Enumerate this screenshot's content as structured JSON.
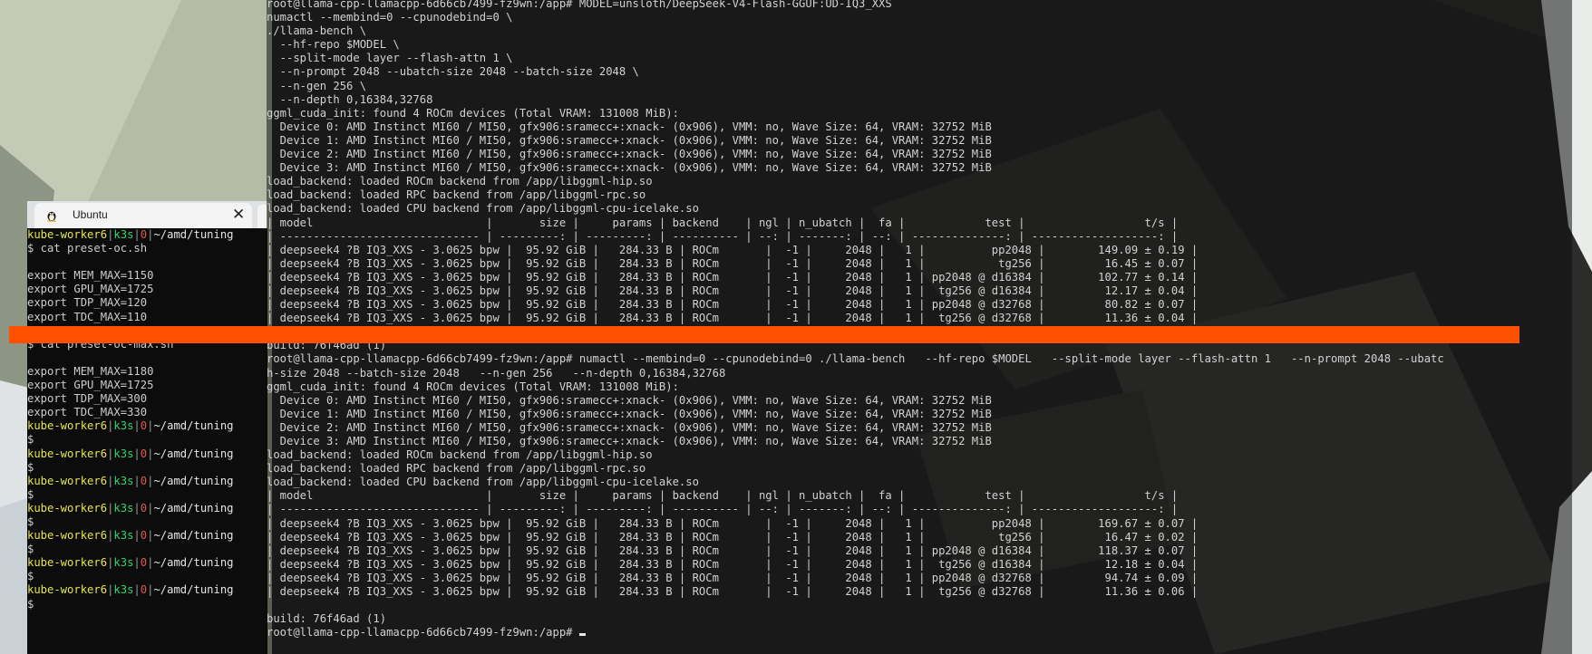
{
  "colors": {
    "terminal_bg": "#0c0c0c",
    "terminal_text": "#cccccc",
    "prompt_host": "#e5e54d",
    "prompt_k3s": "#2fd66a",
    "prompt_ctx": "#e25555",
    "redaction_bar": "#ff5000",
    "tab_bg": "#f4f4f4"
  },
  "left_terminal": {
    "tab": {
      "title": "Ubuntu",
      "icon": "linux-tux-icon",
      "close_glyph": "✕"
    },
    "prompt": {
      "host": "kube-worker6",
      "sep": "|",
      "k3s": "k3s",
      "ctx": "0",
      "path": "~/amd/tuning"
    },
    "lines": [
      {
        "type": "prompt"
      },
      {
        "type": "text",
        "text": "$ cat preset-oc.sh"
      },
      {
        "type": "text",
        "text": ""
      },
      {
        "type": "text",
        "text": "export MEM_MAX=1150"
      },
      {
        "type": "text",
        "text": "export GPU_MAX=1725"
      },
      {
        "type": "text",
        "text": "export TDP_MAX=120"
      },
      {
        "type": "text",
        "text": "export TDC_MAX=110"
      },
      {
        "type": "text",
        "text": ""
      },
      {
        "type": "text",
        "text": "$ cat preset-oc-max.sh"
      },
      {
        "type": "text",
        "text": ""
      },
      {
        "type": "text",
        "text": "export MEM_MAX=1180"
      },
      {
        "type": "text",
        "text": "export GPU_MAX=1725"
      },
      {
        "type": "text",
        "text": "export TDP_MAX=300"
      },
      {
        "type": "text",
        "text": "export TDC_MAX=330"
      },
      {
        "type": "prompt"
      },
      {
        "type": "text",
        "text": "$"
      },
      {
        "type": "prompt"
      },
      {
        "type": "text",
        "text": "$"
      },
      {
        "type": "prompt"
      },
      {
        "type": "text",
        "text": "$"
      },
      {
        "type": "prompt"
      },
      {
        "type": "text",
        "text": "$"
      },
      {
        "type": "prompt"
      },
      {
        "type": "text",
        "text": "$"
      },
      {
        "type": "prompt"
      },
      {
        "type": "text",
        "text": "$"
      },
      {
        "type": "prompt"
      },
      {
        "type": "text",
        "text": "$"
      }
    ]
  },
  "main_terminal": {
    "lines": [
      "root@llama-cpp-llamacpp-6d66cb7499-fz9wn:/app# MODEL=unsloth/DeepSeek-V4-Flash-GGUF:UD-IQ3_XXS",
      "numactl --membind=0 --cpunodebind=0 \\",
      "./llama-bench \\",
      "  --hf-repo $MODEL \\",
      "  --split-mode layer --flash-attn 1 \\",
      "  --n-prompt 2048 --ubatch-size 2048 --batch-size 2048 \\",
      "  --n-gen 256 \\",
      "  --n-depth 0,16384,32768",
      "ggml_cuda_init: found 4 ROCm devices (Total VRAM: 131008 MiB):",
      "  Device 0: AMD Instinct MI60 / MI50, gfx906:sramecc+:xnack- (0x906), VMM: no, Wave Size: 64, VRAM: 32752 MiB",
      "  Device 1: AMD Instinct MI60 / MI50, gfx906:sramecc+:xnack- (0x906), VMM: no, Wave Size: 64, VRAM: 32752 MiB",
      "  Device 2: AMD Instinct MI60 / MI50, gfx906:sramecc+:xnack- (0x906), VMM: no, Wave Size: 64, VRAM: 32752 MiB",
      "  Device 3: AMD Instinct MI60 / MI50, gfx906:sramecc+:xnack- (0x906), VMM: no, Wave Size: 64, VRAM: 32752 MiB",
      "load_backend: loaded ROCm backend from /app/libggml-hip.so",
      "load_backend: loaded RPC backend from /app/libggml-rpc.so",
      "load_backend: loaded CPU backend from /app/libggml-cpu-icelake.so",
      "| model                          |       size |     params | backend    | ngl | n_ubatch |  fa |            test |                  t/s |",
      "| ------------------------------ | ---------: | ---------: | ---------- | --: | -------: | --: | --------------: | -------------------: |",
      "| deepseek4 ?B IQ3_XXS - 3.0625 bpw |  95.92 GiB |   284.33 B | ROCm       |  -1 |     2048 |   1 |          pp2048 |        149.09 ± 0.19 |",
      "| deepseek4 ?B IQ3_XXS - 3.0625 bpw |  95.92 GiB |   284.33 B | ROCm       |  -1 |     2048 |   1 |           tg256 |         16.45 ± 0.07 |",
      "| deepseek4 ?B IQ3_XXS - 3.0625 bpw |  95.92 GiB |   284.33 B | ROCm       |  -1 |     2048 |   1 | pp2048 @ d16384 |        102.77 ± 0.14 |",
      "| deepseek4 ?B IQ3_XXS - 3.0625 bpw |  95.92 GiB |   284.33 B | ROCm       |  -1 |     2048 |   1 |  tg256 @ d16384 |         12.17 ± 0.04 |",
      "| deepseek4 ?B IQ3_XXS - 3.0625 bpw |  95.92 GiB |   284.33 B | ROCm       |  -1 |     2048 |   1 | pp2048 @ d32768 |         80.82 ± 0.07 |",
      "| deepseek4 ?B IQ3_XXS - 3.0625 bpw |  95.92 GiB |   284.33 B | ROCm       |  -1 |     2048 |   1 |  tg256 @ d32768 |         11.36 ± 0.04 |",
      "",
      "build: 76f46ad (1)",
      "root@llama-cpp-llamacpp-6d66cb7499-fz9wn:/app# numactl --membind=0 --cpunodebind=0 ./llama-bench   --hf-repo $MODEL   --split-mode layer --flash-attn 1   --n-prompt 2048 --ubatc",
      "h-size 2048 --batch-size 2048   --n-gen 256   --n-depth 0,16384,32768",
      "ggml_cuda_init: found 4 ROCm devices (Total VRAM: 131008 MiB):",
      "  Device 0: AMD Instinct MI60 / MI50, gfx906:sramecc+:xnack- (0x906), VMM: no, Wave Size: 64, VRAM: 32752 MiB",
      "  Device 1: AMD Instinct MI60 / MI50, gfx906:sramecc+:xnack- (0x906), VMM: no, Wave Size: 64, VRAM: 32752 MiB",
      "  Device 2: AMD Instinct MI60 / MI50, gfx906:sramecc+:xnack- (0x906), VMM: no, Wave Size: 64, VRAM: 32752 MiB",
      "  Device 3: AMD Instinct MI60 / MI50, gfx906:sramecc+:xnack- (0x906), VMM: no, Wave Size: 64, VRAM: 32752 MiB",
      "load_backend: loaded ROCm backend from /app/libggml-hip.so",
      "load_backend: loaded RPC backend from /app/libggml-rpc.so",
      "load_backend: loaded CPU backend from /app/libggml-cpu-icelake.so",
      "| model                          |       size |     params | backend    | ngl | n_ubatch |  fa |            test |                  t/s |",
      "| ------------------------------ | ---------: | ---------: | ---------- | --: | -------: | --: | --------------: | -------------------: |",
      "| deepseek4 ?B IQ3_XXS - 3.0625 bpw |  95.92 GiB |   284.33 B | ROCm       |  -1 |     2048 |   1 |          pp2048 |        169.67 ± 0.07 |",
      "| deepseek4 ?B IQ3_XXS - 3.0625 bpw |  95.92 GiB |   284.33 B | ROCm       |  -1 |     2048 |   1 |           tg256 |         16.47 ± 0.02 |",
      "| deepseek4 ?B IQ3_XXS - 3.0625 bpw |  95.92 GiB |   284.33 B | ROCm       |  -1 |     2048 |   1 | pp2048 @ d16384 |        118.37 ± 0.07 |",
      "| deepseek4 ?B IQ3_XXS - 3.0625 bpw |  95.92 GiB |   284.33 B | ROCm       |  -1 |     2048 |   1 |  tg256 @ d16384 |         12.18 ± 0.04 |",
      "| deepseek4 ?B IQ3_XXS - 3.0625 bpw |  95.92 GiB |   284.33 B | ROCm       |  -1 |     2048 |   1 | pp2048 @ d32768 |         94.74 ± 0.09 |",
      "| deepseek4 ?B IQ3_XXS - 3.0625 bpw |  95.92 GiB |   284.33 B | ROCm       |  -1 |     2048 |   1 |  tg256 @ d32768 |         11.36 ± 0.06 |",
      "",
      "build: 76f46ad (1)",
      "root@llama-cpp-llamacpp-6d66cb7499-fz9wn:/app# "
    ]
  }
}
